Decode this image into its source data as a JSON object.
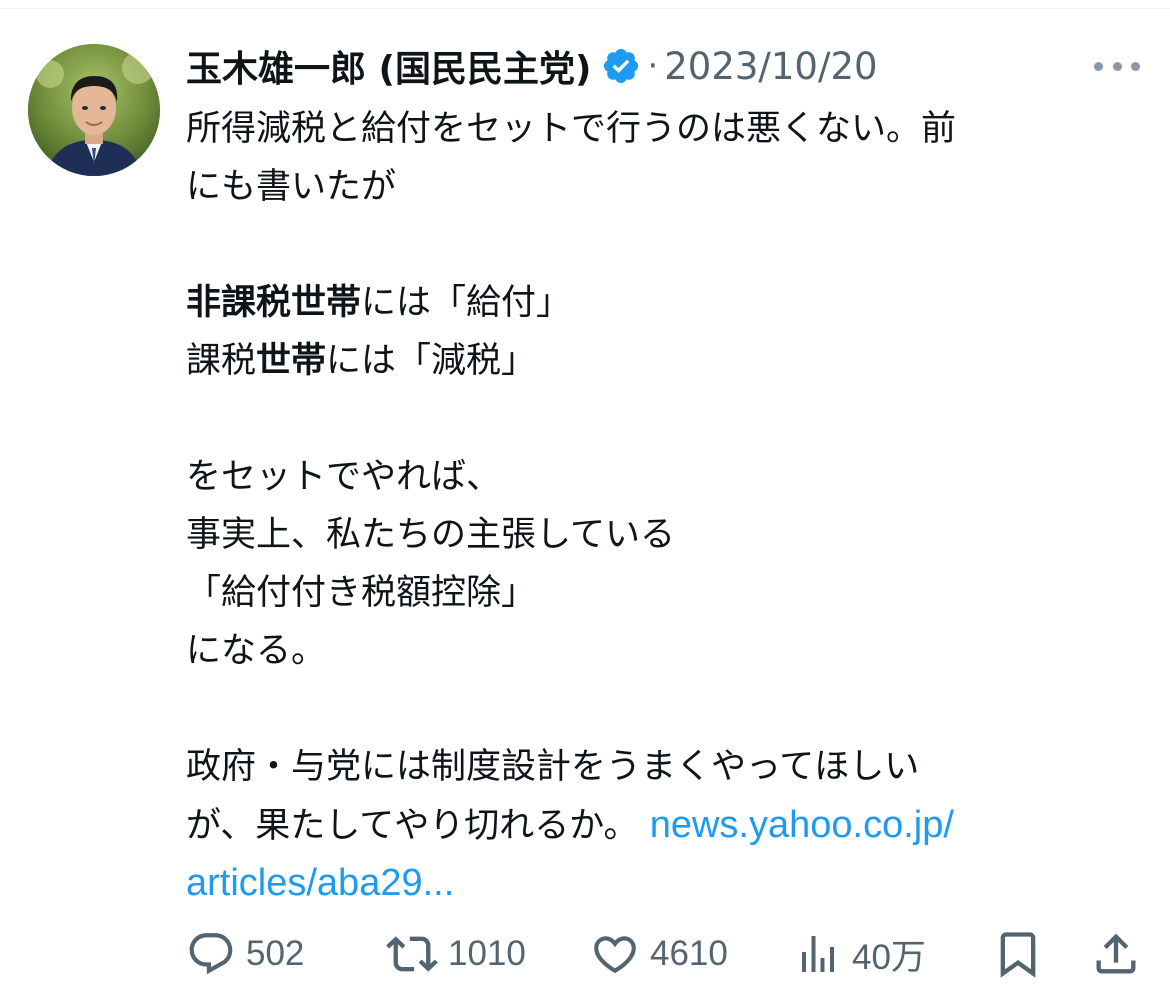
{
  "post": {
    "author_name": "玉木雄一郎 (国民民主党)",
    "separator": "·",
    "date": "2023/10/20",
    "lines": [
      "所得減税と給付をセットで行うのは悪くない。前",
      "にも書いたが",
      "",
      "",
      "",
      "をセットでやれば、",
      "事実上、私たちの主張している",
      "「給付付き税額控除」",
      "になる。",
      "",
      "政府・与党には制度設計をうまくやってほしい",
      "が、果たしてやり切れるか。"
    ],
    "line4_bold": "非課税世帯",
    "line4_rest": "には「給付」",
    "line5_plain": "課税",
    "line5_bold": "世帯",
    "line5_rest": "には「減税」",
    "link_part1": "news.yahoo.co.jp/",
    "link_part2": "articles/aba29..."
  },
  "actions": {
    "replies": "502",
    "reposts": "1010",
    "likes": "4610",
    "views": "40万"
  },
  "icons": {
    "verified": "verified-badge-icon",
    "more": "more-dots-icon",
    "reply": "reply-icon",
    "repost": "repost-icon",
    "like": "heart-icon",
    "views": "views-chart-icon",
    "bookmark": "bookmark-icon",
    "share": "share-icon"
  },
  "colors": {
    "text": "#0f1419",
    "secondary": "#536471",
    "link": "#1d9bf0",
    "verified": "#1d9bf0"
  }
}
